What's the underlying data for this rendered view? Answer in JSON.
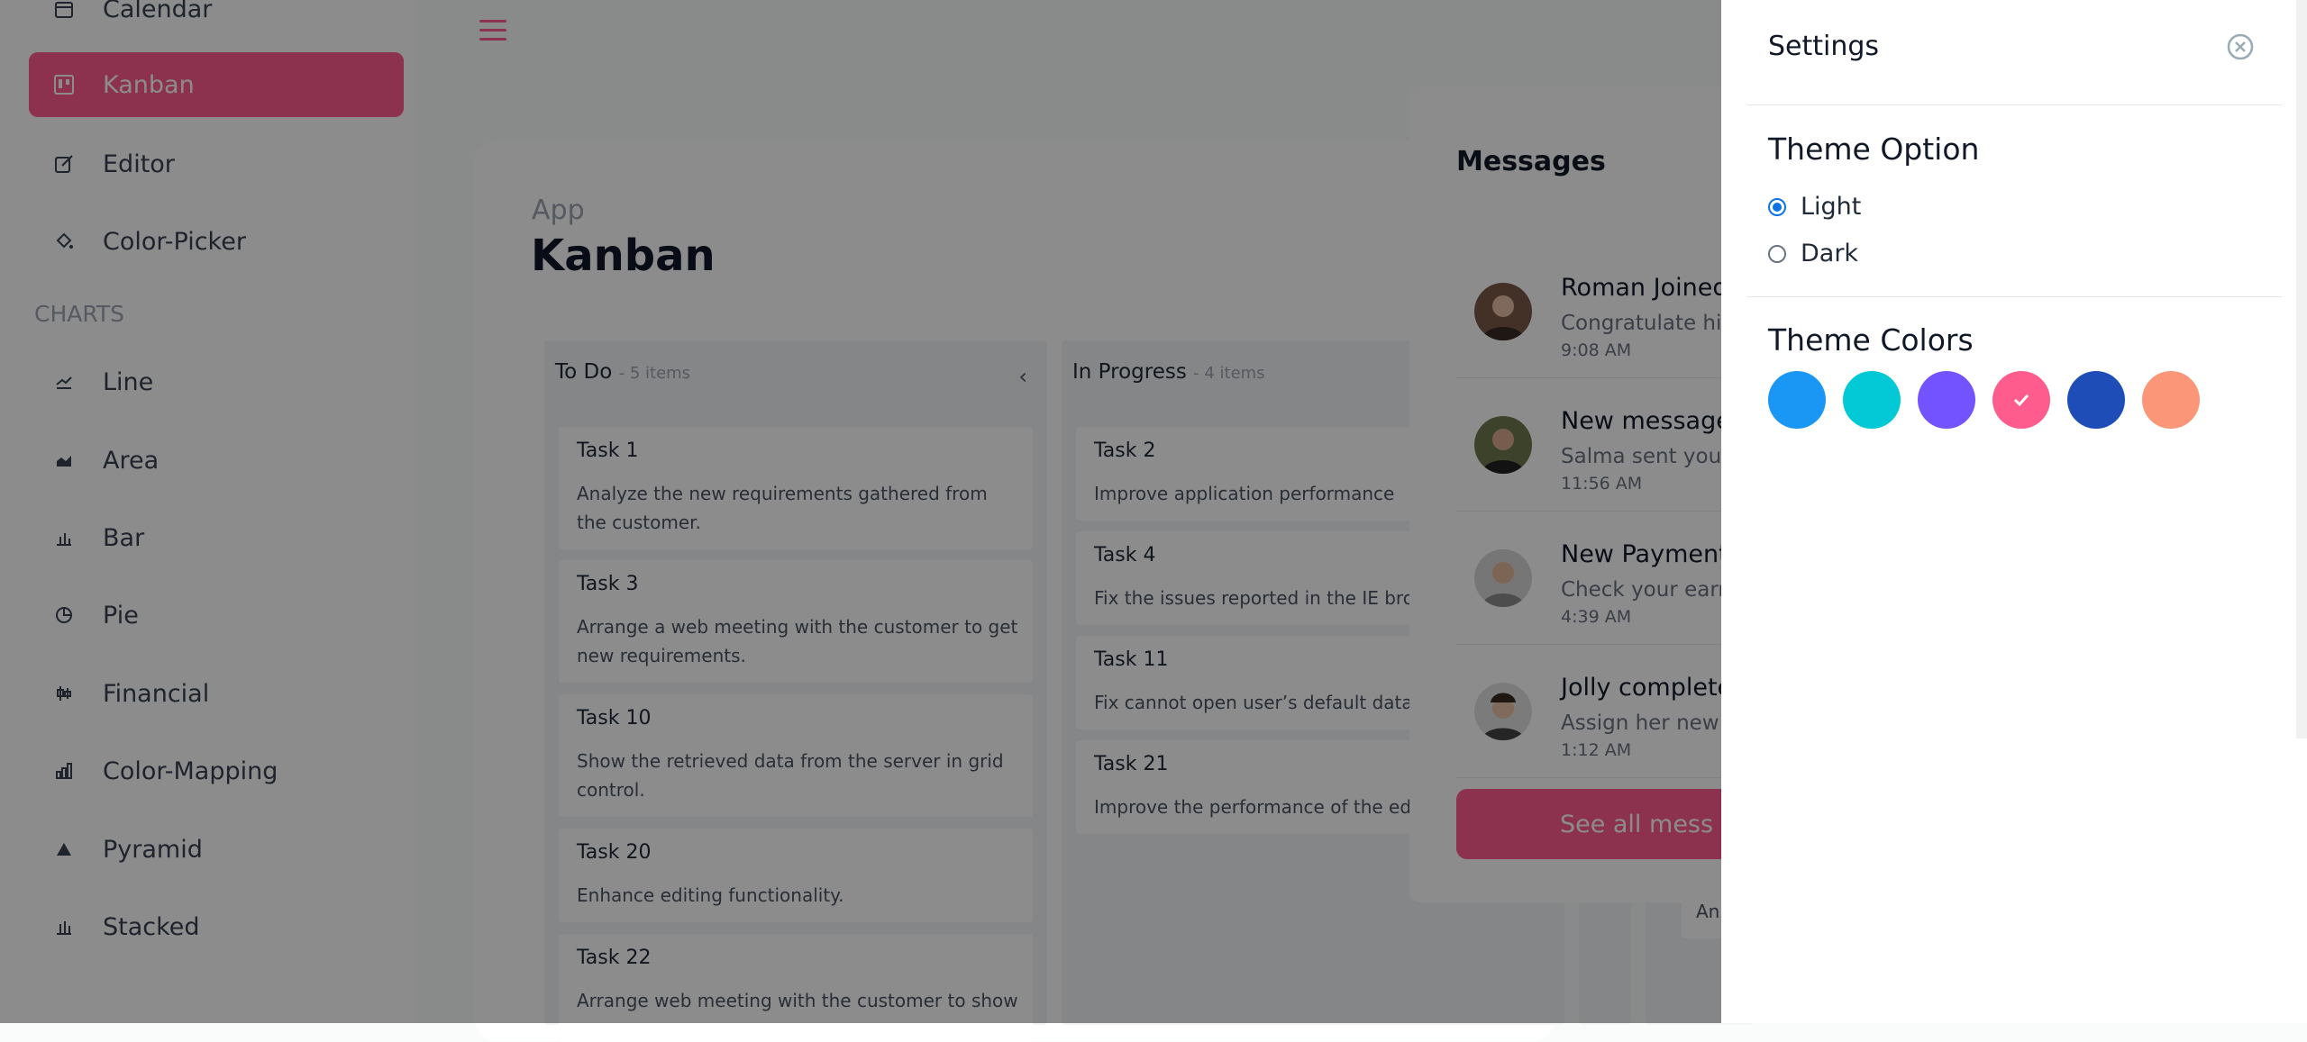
{
  "sidebar": {
    "items": [
      {
        "label": "Calendar",
        "icon": "calendar-icon"
      },
      {
        "label": "Kanban",
        "icon": "kanban-icon"
      },
      {
        "label": "Editor",
        "icon": "edit-icon"
      },
      {
        "label": "Color-Picker",
        "icon": "paint-bucket-icon"
      },
      {
        "label": "Line",
        "icon": "line-chart-icon"
      },
      {
        "label": "Area",
        "icon": "area-chart-icon"
      },
      {
        "label": "Bar",
        "icon": "bar-chart-icon"
      },
      {
        "label": "Pie",
        "icon": "pie-chart-icon"
      },
      {
        "label": "Financial",
        "icon": "financial-chart-icon"
      },
      {
        "label": "Color-Mapping",
        "icon": "color-mapping-icon"
      },
      {
        "label": "Pyramid",
        "icon": "pyramid-icon"
      },
      {
        "label": "Stacked",
        "icon": "stacked-chart-icon"
      }
    ],
    "charts_section": "CHARTS"
  },
  "header": {
    "crumb": "App",
    "title": "Kanban"
  },
  "kanban": {
    "todo": {
      "title": "To Do",
      "count": "- 5 items",
      "cards": [
        {
          "title": "Task 1",
          "desc": "Analyze the new requirements gathered from the customer."
        },
        {
          "title": "Task 3",
          "desc": "Arrange a web meeting with the customer to get new requirements."
        },
        {
          "title": "Task 10",
          "desc": "Show the retrieved data from the server in grid control."
        },
        {
          "title": "Task 20",
          "desc": "Enhance editing functionality."
        },
        {
          "title": "Task 22",
          "desc": "Arrange web meeting with the customer to show"
        }
      ]
    },
    "inprogress": {
      "title": "In Progress",
      "count": "- 4 items",
      "cards": [
        {
          "title": "Task 2",
          "desc": "Improve application performance"
        },
        {
          "title": "Task 4",
          "desc": "Fix the issues reported in the IE brows"
        },
        {
          "title": "Task 11",
          "desc": "Fix cannot open user’s default databas"
        },
        {
          "title": "Task 21",
          "desc": "Improve the performance of the editin"
        }
      ]
    },
    "partial_card_text": "An"
  },
  "messages": {
    "title": "Messages",
    "items": [
      {
        "name": "Roman Joined",
        "desc": "Congratulate him",
        "time": "9:08 AM"
      },
      {
        "name": "New message",
        "desc": "Salma sent you n",
        "time": "11:56 AM"
      },
      {
        "name": "New Payment",
        "desc": "Check your earnin",
        "time": "4:39 AM"
      },
      {
        "name": "Jolly completed",
        "desc": "Assign her new ta",
        "time": "1:12 AM"
      }
    ],
    "see_all": "See all mess"
  },
  "settings": {
    "title": "Settings",
    "theme_option": "Theme Option",
    "light": "Light",
    "dark": "Dark",
    "theme_colors": "Theme Colors",
    "colors": [
      "#1a97f5",
      "#03c9d7",
      "#7352ff",
      "#ff5c8e",
      "#1e4db7",
      "#fb9678"
    ],
    "selected_color": "#ff5c8e"
  }
}
